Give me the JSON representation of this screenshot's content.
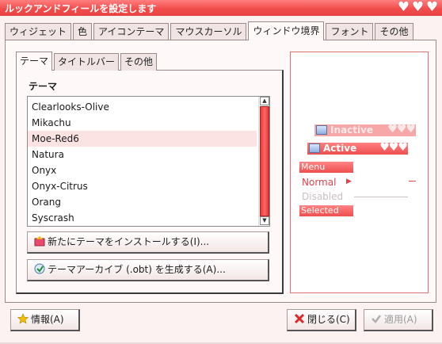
{
  "window": {
    "title": "ルックアンドフィールを設定します"
  },
  "tabs": [
    {
      "label": "ウィジェット"
    },
    {
      "label": "色"
    },
    {
      "label": "アイコンテーマ"
    },
    {
      "label": "マウスカーソル"
    },
    {
      "label": "ウィンドウ境界",
      "active": true
    },
    {
      "label": "フォント"
    },
    {
      "label": "その他"
    }
  ],
  "subtabs": [
    {
      "label": "テーマ",
      "active": true
    },
    {
      "label": "タイトルバー"
    },
    {
      "label": "その他"
    }
  ],
  "theme_section": {
    "label": "テーマ",
    "items": [
      "Clearlooks-Olive",
      "Mikachu",
      "Moe-Red6",
      "Natura",
      "Onyx",
      "Onyx-Citrus",
      "Orang",
      "Syscrash"
    ],
    "selected": "Moe-Red6",
    "scroll": {
      "up_glyph": "▲",
      "down_glyph": "▼"
    }
  },
  "buttons": {
    "install": "新たにテーマをインストールする(I)...",
    "archive": "テーマアーカイブ (.obt) を生成する(A)...",
    "info": "情報(A)",
    "close": "閉じる(C)",
    "apply": "適用(A)"
  },
  "preview": {
    "inactive_title": "Inactive",
    "active_title": "Active",
    "menu_label": "Menu",
    "normal_item": "Normal",
    "disabled_item": "Disabled",
    "selected_item": "Selected"
  },
  "icons": {
    "window_controls": [
      "heart-icon",
      "heart-icon",
      "heart-icon"
    ],
    "install": "install-icon",
    "archive": "archive-icon",
    "info": "star-icon",
    "close": "x-icon",
    "apply": "check-icon"
  },
  "colors": {
    "accent": "#ee4e4e",
    "titlebar": "#f24d4d",
    "panel": "#fff8f8",
    "selection": "#fbe3e3"
  }
}
